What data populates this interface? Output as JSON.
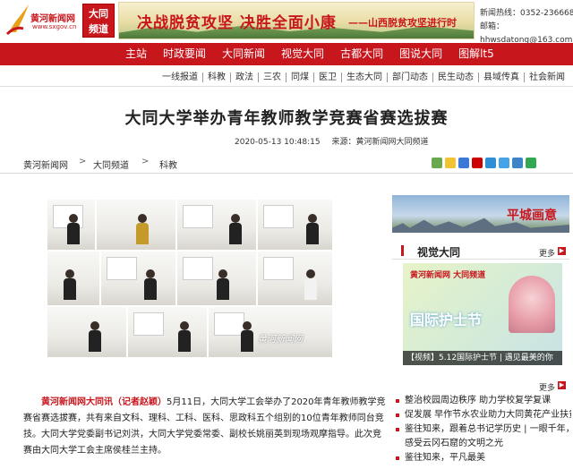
{
  "header": {
    "logo_name": "黄河新闻网",
    "logo_url": "www.sxgov.cn",
    "channel_badge": [
      "大同",
      "频道"
    ],
    "banner_slogan": "决战脱贫攻坚  决胜全面小康",
    "banner_sub": "——山西脱贫攻坚进行时",
    "contact": {
      "hotline": "新闻热线：0352-2366688",
      "email_label": "邮箱：",
      "email": "hhwsdatong@163.com"
    }
  },
  "nav": {
    "items": [
      "主站",
      "时政要闻",
      "大同新闻",
      "视觉大同",
      "古都大同",
      "图说大同",
      "图解lt5"
    ]
  },
  "subnav": {
    "items": [
      "一线报道",
      "科教",
      "政法",
      "三农",
      "同煤",
      "医卫",
      "生态大同",
      "部门动态",
      "民生动态",
      "县域传真",
      "社会新闻"
    ]
  },
  "article": {
    "title": "大同大学举办青年教师教学竞赛省赛选拔赛",
    "date": "2020-05-13 10:48:15",
    "source": "来源：黄河新闻网大同频道",
    "lead": "黄河新闻网大同讯（记者赵颖）",
    "body": "5月11日，大同大学工会举办了2020年青年教师教学竞赛省赛选拔赛，共有来自文科、理科、工科、医科、思政科五个组别的10位青年教师同台竞技。大同大学党委副书记刘洪，大同大学党委常委、副校长姚丽英到现场观摩指导。此次竞赛由大同大学工会主席侯桂兰主持。",
    "photo_watermark": "黄河新闻网"
  },
  "breadcrumb": {
    "items": [
      "黄河新闻网",
      "大同频道",
      "科教"
    ],
    "separator": ">"
  },
  "share": {
    "colors": [
      "#6aa84f",
      "#f1c232",
      "#3c78d8",
      "#cc0000",
      "#2f8fd5",
      "#46a3e8",
      "#3d85c6",
      "#34a853"
    ]
  },
  "right": {
    "ad_text": "平城画意",
    "visual": {
      "title": "视觉大同",
      "more": "更多",
      "brand": "黄河新闻网 大同频道",
      "big_text": "国际护士节",
      "caption": "【视频】5.12国际护士节 | 遇见最美的你"
    },
    "news": {
      "more": "更多",
      "items": [
        "整治校园周边秩序 助力学校复学复课",
        "促发展 早作节水农业助力大同黄花产业扶贫",
        "鉴往知来，跟着总书记学历史 | 一眼千年，",
        "感受云冈石窟的文明之光",
        "鉴往知来，平凡最美"
      ]
    }
  }
}
